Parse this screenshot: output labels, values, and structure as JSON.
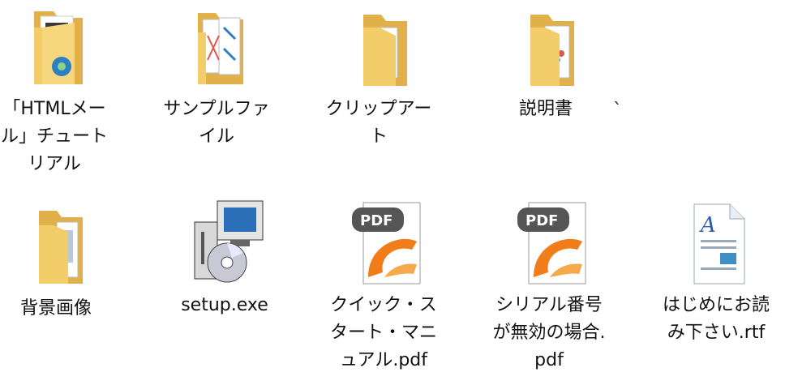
{
  "items": [
    {
      "id": "html-mail-tutorial",
      "label": "「HTMLメール」チュートリアル",
      "icon": "folder-icon"
    },
    {
      "id": "sample-file",
      "label": "サンプルファイル",
      "icon": "folder-icon"
    },
    {
      "id": "clip-art",
      "label": "クリップアート",
      "icon": "folder-icon"
    },
    {
      "id": "manual",
      "label": "説明書",
      "icon": "folder-icon"
    },
    {
      "id": "background-images",
      "label": "背景画像",
      "icon": "folder-icon"
    },
    {
      "id": "setup-exe",
      "label": "setup.exe",
      "icon": "installer-icon"
    },
    {
      "id": "quick-start-pdf",
      "label": "クイック・スタート・マニュアル.pdf",
      "icon": "pdf-icon"
    },
    {
      "id": "serial-invalid-pdf",
      "label": "シリアル番号が無効の場合.pdf",
      "icon": "pdf-icon"
    },
    {
      "id": "readme-rtf",
      "label": "はじめにお読み下さい.rtf",
      "icon": "rtf-document-icon"
    }
  ],
  "stray_mark": "`",
  "colors": {
    "folder_body": "#f3cd6a",
    "folder_back": "#e2b04a",
    "pdf_badge": "#555555",
    "pdf_swoosh": "#f07d1a"
  }
}
